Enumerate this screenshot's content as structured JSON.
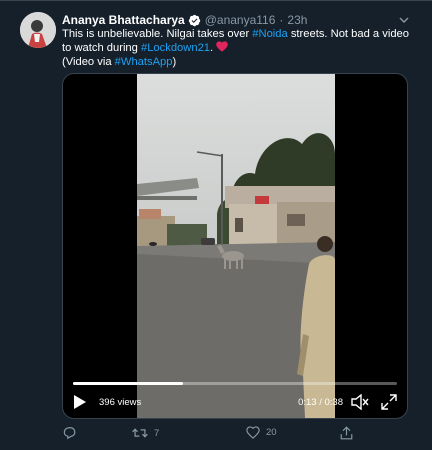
{
  "author": {
    "name": "Ananya Bhattacharya",
    "handle": "@ananya116",
    "separator": "·",
    "time": "23h"
  },
  "tweet": {
    "part1": "This is unbelievable. Nilgai takes over ",
    "tag_noida": "#Noida",
    "part2": " streets. Not bad a video to watch during ",
    "tag_lockdown": "#Lockdown21",
    "part3": ".",
    "part4": "(Video via ",
    "tag_whatsapp": "#WhatsApp",
    "part5": ")"
  },
  "video": {
    "views": "396 views",
    "time_readout": "0:13 / 0:38",
    "progress": 0.34
  },
  "actions": {
    "retweets": "7",
    "likes": "20"
  },
  "colors": {
    "background": "#15202b",
    "link": "#1da1f2",
    "secondary_text": "#8899a6",
    "heart": "#e0245e"
  },
  "icons": [
    "verified-icon",
    "chevron-down-icon",
    "heart-emoji-icon",
    "play-icon",
    "volume-icon",
    "fullscreen-icon",
    "reply-icon",
    "retweet-icon",
    "like-icon",
    "share-icon"
  ]
}
